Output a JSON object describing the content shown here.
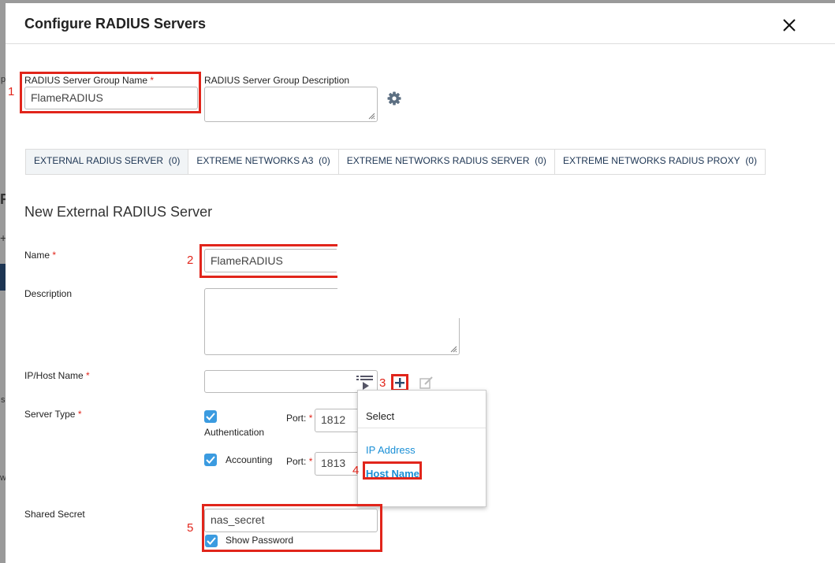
{
  "modal": {
    "title": "Configure RADIUS Servers"
  },
  "group": {
    "name_label": "RADIUS Server Group Name",
    "name_value": "FlameRADIUS",
    "description_label": "RADIUS Server Group Description",
    "description_value": ""
  },
  "tabs": [
    {
      "label": "EXTERNAL RADIUS SERVER",
      "count": "(0)"
    },
    {
      "label": "EXTREME NETWORKS A3",
      "count": "(0)"
    },
    {
      "label": "EXTREME NETWORKS RADIUS SERVER",
      "count": "(0)"
    },
    {
      "label": "EXTREME NETWORKS RADIUS PROXY",
      "count": "(0)"
    }
  ],
  "form": {
    "section_title": "New External RADIUS Server",
    "name_label": "Name",
    "name_value": "FlameRADIUS",
    "description_label": "Description",
    "ip_label": "IP/Host Name",
    "ip_value": "",
    "server_type_label": "Server Type",
    "authentication_label": "Authentication",
    "accounting_label": "Accounting",
    "port_label": "Port:",
    "auth_port": "1812",
    "acct_port": "1813",
    "shared_secret_label": "Shared Secret",
    "shared_secret_value": "nas_secret",
    "show_password_label": "Show Password"
  },
  "dropdown": {
    "header": "Select",
    "items": [
      "IP Address",
      "Host Name"
    ]
  },
  "annotations": [
    "1",
    "2",
    "3",
    "4",
    "5"
  ],
  "background": {
    "peek_chars": [
      "p",
      "R",
      "+",
      "s",
      "w"
    ]
  },
  "colors": {
    "highlight": "#e1251b",
    "link": "#1a8fd6",
    "checkbox": "#3b9be0",
    "tab_text": "#1d3553"
  }
}
